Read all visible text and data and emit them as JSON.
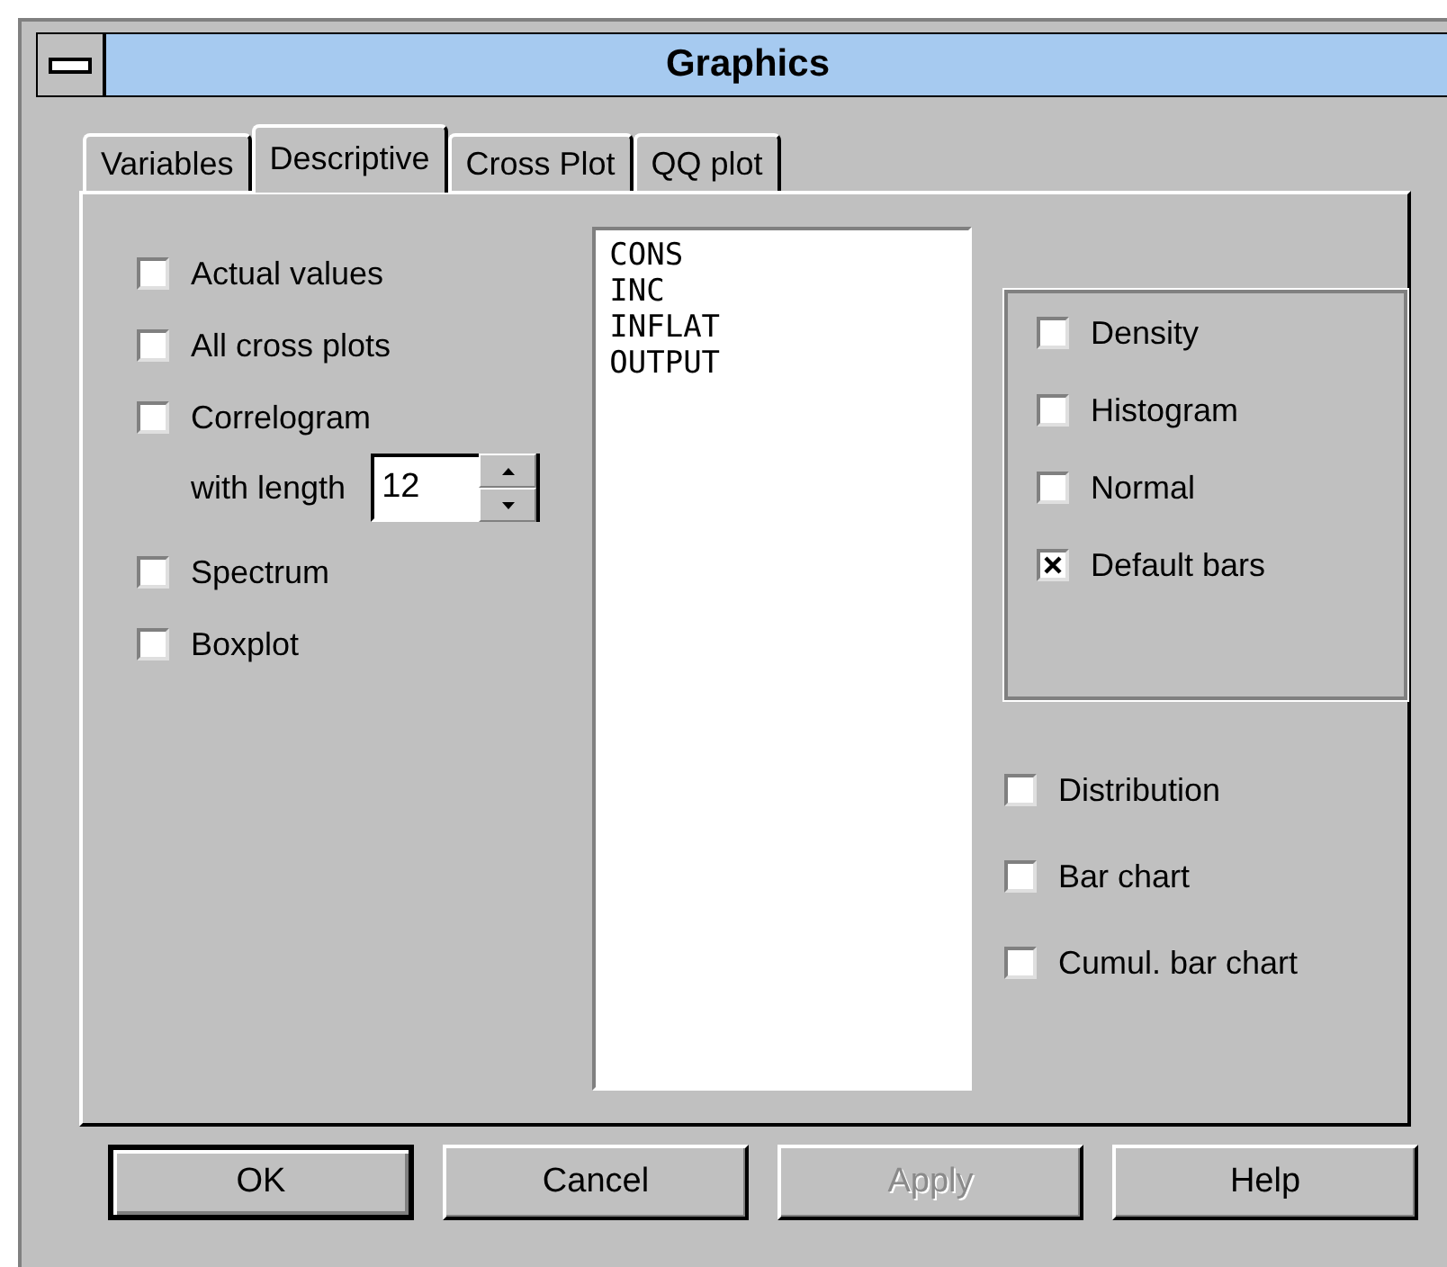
{
  "window": {
    "title": "Graphics"
  },
  "tabs": [
    {
      "label": "Variables",
      "selected": false
    },
    {
      "label": "Descriptive",
      "selected": true
    },
    {
      "label": "Cross Plot",
      "selected": false
    },
    {
      "label": "QQ plot",
      "selected": false
    }
  ],
  "left_options": [
    {
      "label": "Actual values",
      "checked": false
    },
    {
      "label": "All cross plots",
      "checked": false
    },
    {
      "label": "Correlogram",
      "checked": false
    },
    {
      "label": "Spectrum",
      "checked": false
    },
    {
      "label": "Boxplot",
      "checked": false
    }
  ],
  "correlogram_length": {
    "label": "with length",
    "value": "12"
  },
  "variables": [
    "CONS",
    "INC",
    "INFLAT",
    "OUTPUT"
  ],
  "group_options": [
    {
      "label": "Density",
      "checked": false
    },
    {
      "label": "Histogram",
      "checked": false
    },
    {
      "label": "Normal",
      "checked": false
    },
    {
      "label": "Default bars",
      "checked": true
    }
  ],
  "right_options": [
    {
      "label": "Distribution",
      "checked": false
    },
    {
      "label": "Bar chart",
      "checked": false
    },
    {
      "label": "Cumul. bar chart",
      "checked": false
    }
  ],
  "buttons": [
    {
      "label": "OK",
      "default": true,
      "disabled": false
    },
    {
      "label": "Cancel",
      "default": false,
      "disabled": false
    },
    {
      "label": "Apply",
      "default": false,
      "disabled": true
    },
    {
      "label": "Help",
      "default": false,
      "disabled": false
    }
  ]
}
